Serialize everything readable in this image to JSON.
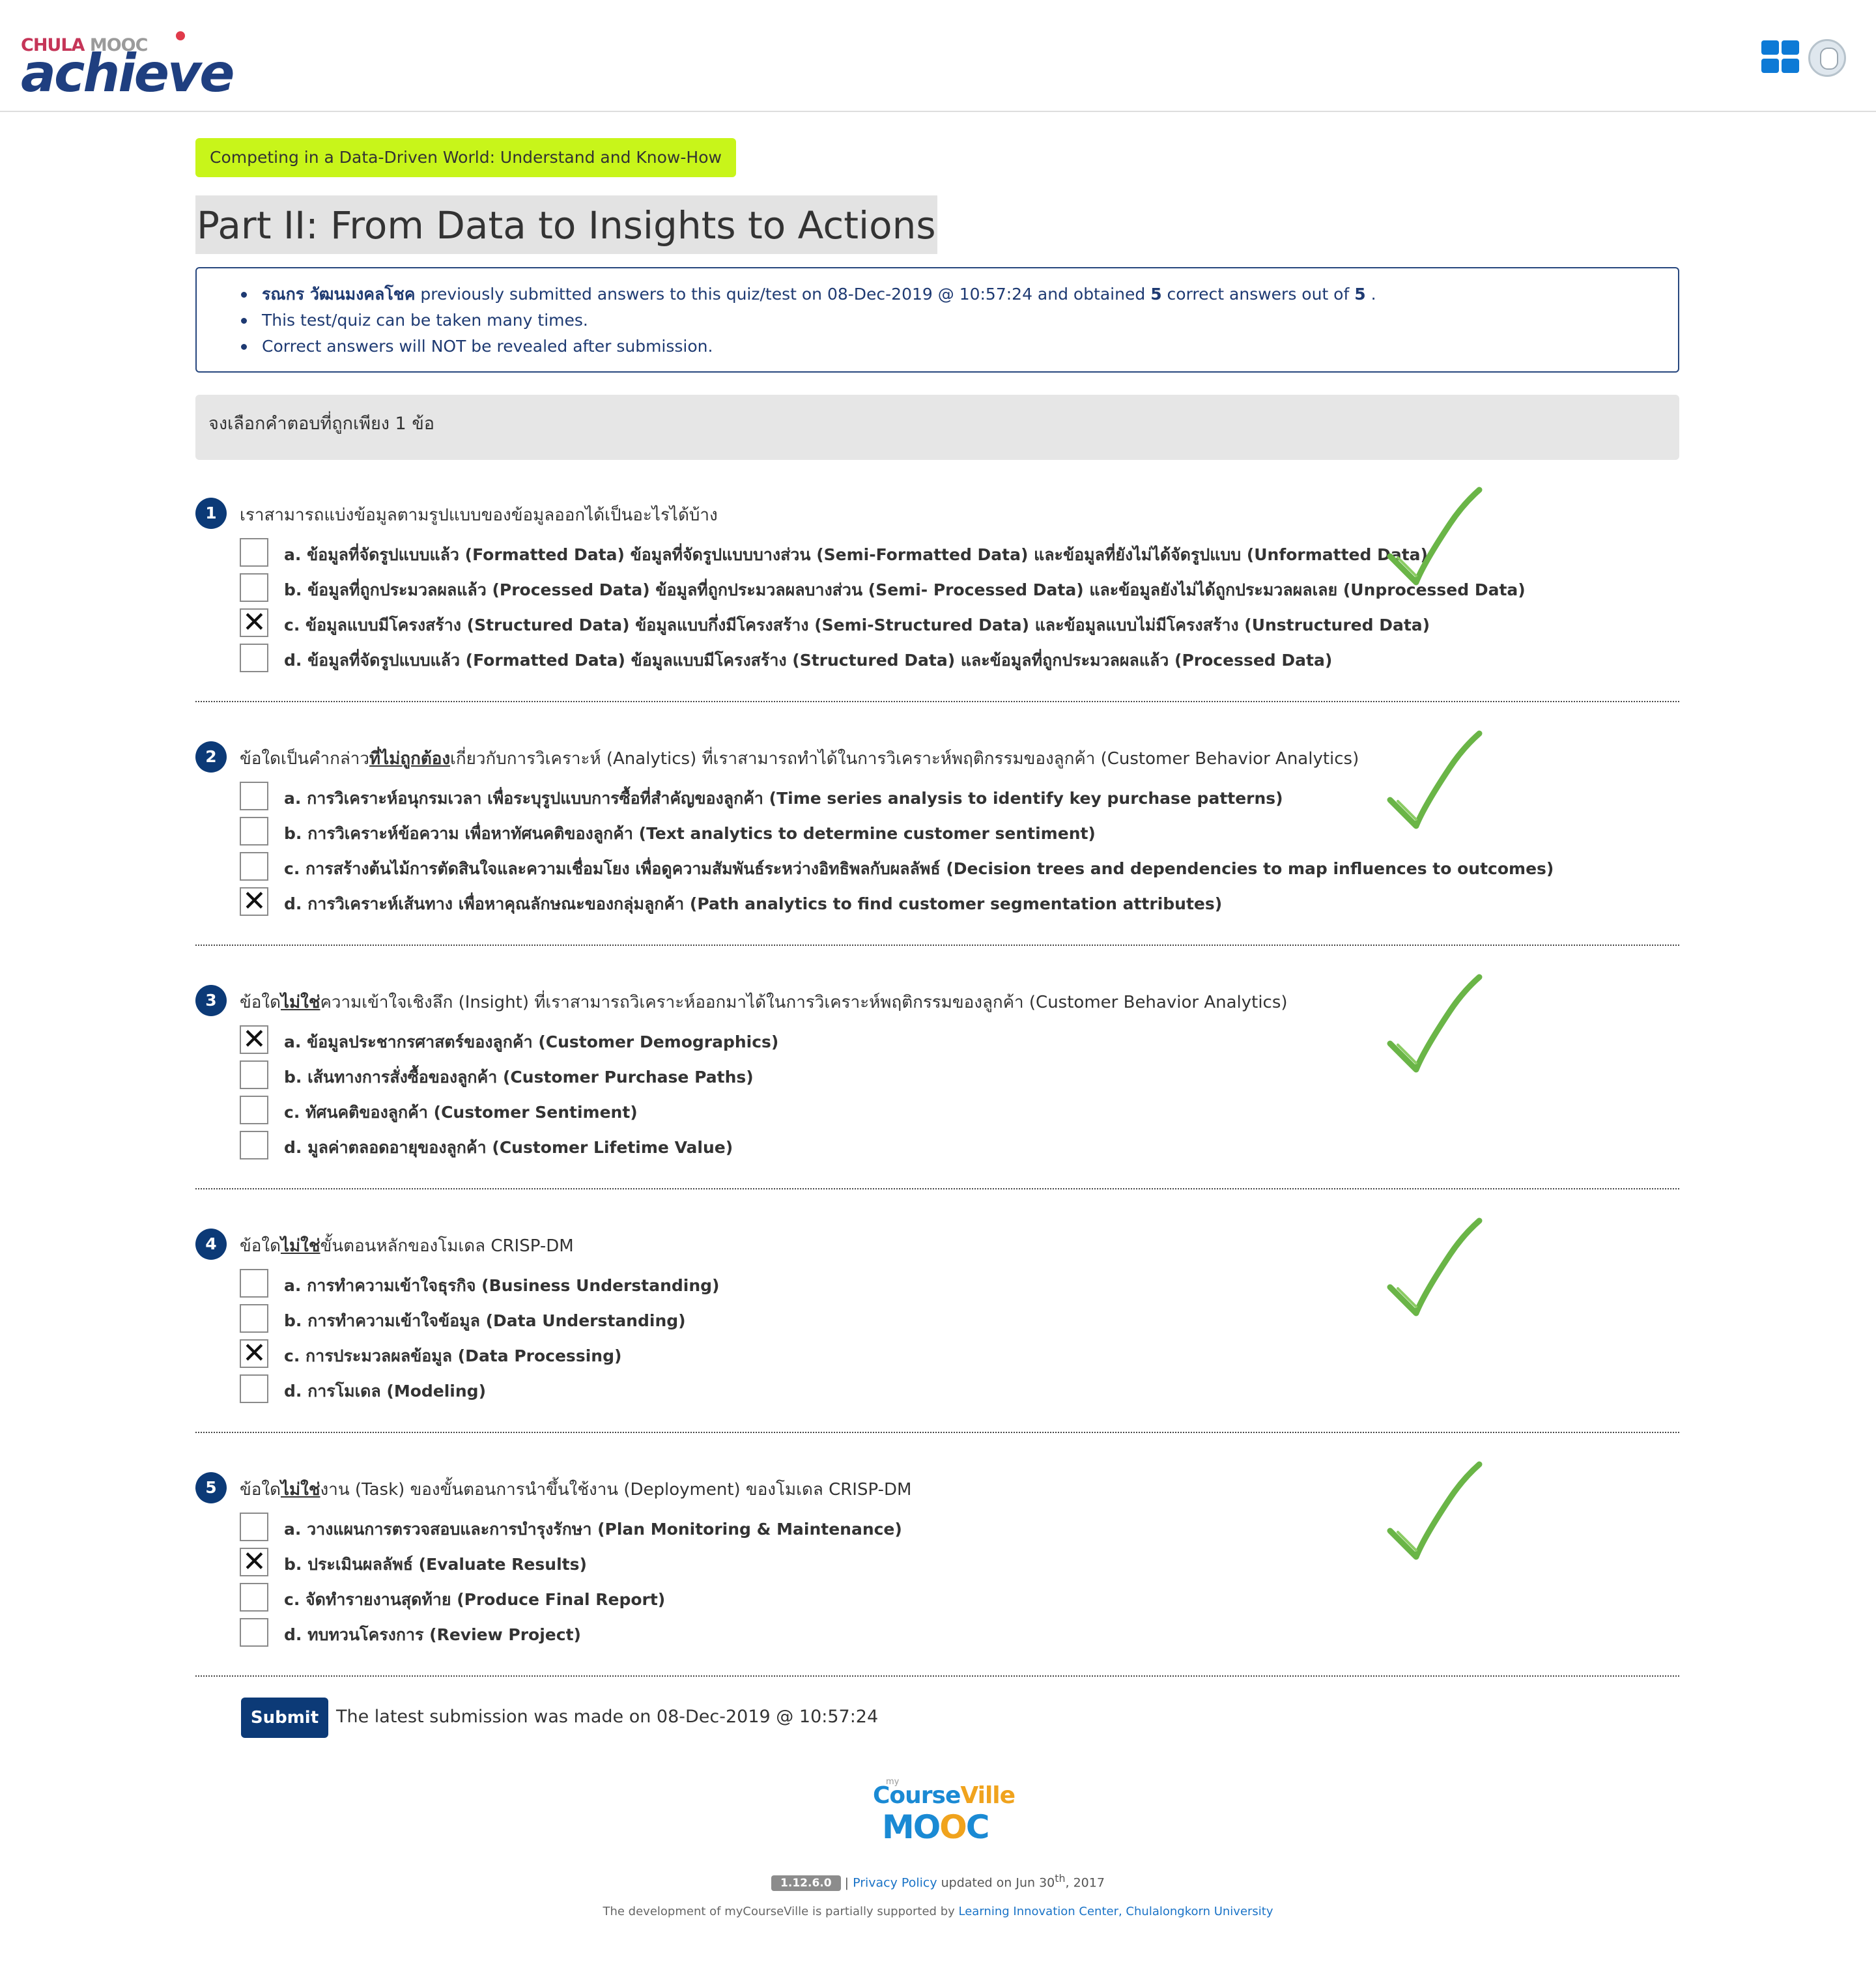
{
  "header": {
    "logo_top_left": "CHULA",
    "logo_top_right": "MOOC",
    "logo_main": "achieve"
  },
  "course_badge": "Competing in a Data-Driven World: Understand and Know-How",
  "page_title": "Part II: From Data to Insights to Actions",
  "info": {
    "student_name": "รณกร วัฒนมงคลโชค",
    "line1_middle": "previously submitted answers to this quiz/test on 08-Dec-2019 @ 10:57:24 and obtained",
    "correct": "5",
    "line1_after": "correct answers out of",
    "total": "5",
    "line1_end": ".",
    "line2": "This test/quiz can be taken many times.",
    "line3": "Correct answers will NOT be revealed after submission."
  },
  "instruction": "จงเลือกคำตอบที่ถูกเพียง 1 ข้อ",
  "questions": [
    {
      "number": "1",
      "pre": "เราสามารถแบ่งข้อมูลตามรูปแบบของข้อมูลออกได้เป็นอะไรได้บ้าง",
      "emph": "",
      "post": "",
      "choices": [
        "a. ข้อมูลที่จัดรูปแบบแล้ว (Formatted Data) ข้อมูลที่จัดรูปแบบบางส่วน (Semi-Formatted Data) และข้อมูลที่ยังไม่ได้จัดรูปแบบ (Unformatted Data)",
        "b. ข้อมูลที่ถูกประมวลผลแล้ว (Processed Data) ข้อมูลที่ถูกประมวลผลบางส่วน (Semi- Processed Data) และข้อมูลยังไม่ได้ถูกประมวลผลเลย (Unprocessed Data)",
        "c. ข้อมูลแบบมีโครงสร้าง (Structured Data) ข้อมูลแบบกึ่งมีโครงสร้าง (Semi-Structured Data) และข้อมูลแบบไม่มีโครงสร้าง (Unstructured Data)",
        "d. ข้อมูลที่จัดรูปแบบแล้ว (Formatted Data) ข้อมูลแบบมีโครงสร้าง (Structured Data) และข้อมูลที่ถูกประมวลผลแล้ว (Processed Data)"
      ],
      "selected": 2
    },
    {
      "number": "2",
      "pre": "ข้อใดเป็นคำกล่าว",
      "emph": "ที่ไม่ถูกต้อง",
      "post": "เกี่ยวกับการวิเคราะห์ (Analytics) ที่เราสามารถทำได้ในการวิเคราะห์พฤติกรรมของลูกค้า (Customer Behavior Analytics)",
      "choices": [
        "a. การวิเคราะห์อนุกรมเวลา เพื่อระบุรูปแบบการซื้อที่สำคัญของลูกค้า (Time series analysis to identify key purchase patterns)",
        "b. การวิเคราะห์ข้อความ เพื่อหาทัศนคติของลูกค้า (Text analytics to determine customer sentiment)",
        "c. การสร้างต้นไม้การตัดสินใจและความเชื่อมโยง เพื่อดูความสัมพันธ์ระหว่างอิทธิพลกับผลลัพธ์ (Decision trees and dependencies to map influences to outcomes)",
        "d. การวิเคราะห์เส้นทาง เพื่อหาคุณลักษณะของกลุ่มลูกค้า (Path analytics to find customer segmentation attributes)"
      ],
      "selected": 3
    },
    {
      "number": "3",
      "pre": "ข้อใด",
      "emph": "ไม่ใช่",
      "post": "ความเข้าใจเชิงลึก (Insight) ที่เราสามารถวิเคราะห์ออกมาได้ในการวิเคราะห์พฤติกรรมของลูกค้า (Customer Behavior Analytics)",
      "choices": [
        "a. ข้อมูลประชากรศาสตร์ของลูกค้า (Customer Demographics)",
        "b. เส้นทางการสั่งซื้อของลูกค้า (Customer Purchase Paths)",
        "c. ทัศนคติของลูกค้า (Customer Sentiment)",
        "d. มูลค่าตลอดอายุของลูกค้า (Customer Lifetime Value)"
      ],
      "selected": 0
    },
    {
      "number": "4",
      "pre": "ข้อใด",
      "emph": "ไม่ใช่",
      "post": "ขั้นตอนหลักของโมเดล CRISP-DM",
      "choices": [
        "a. การทำความเข้าใจธุรกิจ (Business Understanding)",
        "b. การทำความเข้าใจข้อมูล (Data Understanding)",
        "c. การประมวลผลข้อมูล (Data Processing)",
        "d. การโมเดล (Modeling)"
      ],
      "selected": 2
    },
    {
      "number": "5",
      "pre": "ข้อใด",
      "emph": "ไม่ใช่",
      "post": "งาน (Task) ของขั้นตอนการนำขึ้นใช้งาน (Deployment) ของโมเดล CRISP-DM",
      "choices": [
        "a. วางแผนการตรวจสอบและการบำรุงรักษา (Plan Monitoring & Maintenance)",
        "b. ประเมินผลลัพธ์ (Evaluate Results)",
        "c. จัดทำรายงานสุดท้าย (Produce Final Report)",
        "d. ทบทวนโครงการ (Review Project)"
      ],
      "selected": 1
    }
  ],
  "submit": {
    "label": "Submit",
    "note": "The latest submission was made on 08-Dec-2019 @ 10:57:24"
  },
  "footer": {
    "logo_my": "my",
    "logo_course": "Course",
    "logo_ville": "Ville",
    "logo_mooc_m": "M",
    "logo_mooc_o1": "O",
    "logo_mooc_o2": "O",
    "logo_mooc_c": "C",
    "version": "1.12.6.0",
    "sep": "|",
    "privacy": "Privacy Policy",
    "updated": "updated on Jun 30",
    "updated_sup": "th",
    "updated_year": ", 2017",
    "support_text": "The development of myCourseVille is partially supported by",
    "support_link": "Learning Innovation Center, Chulalongkorn University"
  },
  "colors": {
    "brand_navy": "#0c3a77",
    "badge_green": "#c8f51a",
    "check_green": "#6ab547",
    "link_blue": "#1a73c7"
  }
}
